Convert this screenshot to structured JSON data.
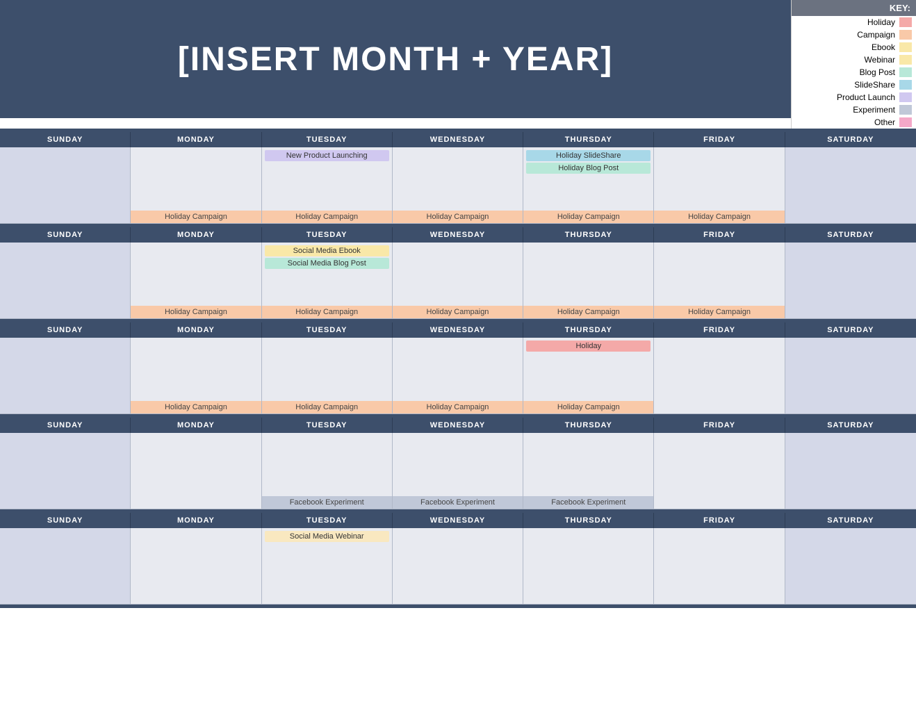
{
  "header": {
    "title": "[INSERT MONTH + YEAR]"
  },
  "key": {
    "label": "KEY:",
    "items": [
      {
        "name": "Holiday",
        "color": "#f4a9a8"
      },
      {
        "name": "Campaign",
        "color": "#f9c9a8"
      },
      {
        "name": "Ebook",
        "color": "#f9e8a8"
      },
      {
        "name": "Webinar",
        "color": "#f9e8a8"
      },
      {
        "name": "Blog Post",
        "color": "#b8e8d8"
      },
      {
        "name": "SlideShare",
        "color": "#a8d8e8"
      },
      {
        "name": "Product Launch",
        "color": "#d0c8f0"
      },
      {
        "name": "Experiment",
        "color": "#c0c8d8"
      },
      {
        "name": "Other",
        "color": "#f4a8c8"
      }
    ]
  },
  "days_of_week": [
    "SUNDAY",
    "MONDAY",
    "TUESDAY",
    "WEDNESDAY",
    "THURSDAY",
    "FRIDAY",
    "SATURDAY"
  ],
  "weeks": [
    {
      "days": [
        {
          "events": [],
          "bottom": ""
        },
        {
          "events": [],
          "bottom": "Holiday Campaign"
        },
        {
          "events": [
            "New Product Launching"
          ],
          "event_types": [
            "product"
          ],
          "bottom": "Holiday Campaign"
        },
        {
          "events": [],
          "bottom": "Holiday Campaign"
        },
        {
          "events": [
            "Holiday SlideShare",
            "Holiday Blog Post"
          ],
          "event_types": [
            "slideshare",
            "blog"
          ],
          "bottom": "Holiday Campaign"
        },
        {
          "events": [],
          "bottom": "Holiday Campaign"
        },
        {
          "events": [],
          "bottom": ""
        }
      ]
    },
    {
      "days": [
        {
          "events": [],
          "bottom": ""
        },
        {
          "events": [],
          "bottom": "Holiday Campaign"
        },
        {
          "events": [
            "Social Media Ebook",
            "Social Media Blog Post"
          ],
          "event_types": [
            "ebook",
            "blog"
          ],
          "bottom": "Holiday Campaign"
        },
        {
          "events": [],
          "bottom": "Holiday Campaign"
        },
        {
          "events": [],
          "bottom": "Holiday Campaign"
        },
        {
          "events": [],
          "bottom": "Holiday Campaign"
        },
        {
          "events": [],
          "bottom": ""
        }
      ]
    },
    {
      "days": [
        {
          "events": [],
          "bottom": ""
        },
        {
          "events": [],
          "bottom": "Holiday Campaign"
        },
        {
          "events": [],
          "bottom": "Holiday Campaign"
        },
        {
          "events": [],
          "bottom": "Holiday Campaign"
        },
        {
          "events": [
            "Holiday"
          ],
          "event_types": [
            "holiday"
          ],
          "bottom": "Holiday Campaign"
        },
        {
          "events": [],
          "bottom": ""
        },
        {
          "events": [],
          "bottom": ""
        }
      ]
    },
    {
      "days": [
        {
          "events": [],
          "bottom": ""
        },
        {
          "events": [],
          "bottom": ""
        },
        {
          "events": [],
          "bottom": "Facebook Experiment"
        },
        {
          "events": [],
          "bottom": "Facebook Experiment"
        },
        {
          "events": [],
          "bottom": "Facebook Experiment"
        },
        {
          "events": [],
          "bottom": ""
        },
        {
          "events": [],
          "bottom": ""
        }
      ]
    },
    {
      "days": [
        {
          "events": [],
          "bottom": ""
        },
        {
          "events": [],
          "bottom": ""
        },
        {
          "events": [
            "Social Media Webinar"
          ],
          "event_types": [
            "webinar"
          ],
          "bottom": ""
        },
        {
          "events": [],
          "bottom": ""
        },
        {
          "events": [],
          "bottom": ""
        },
        {
          "events": [],
          "bottom": ""
        },
        {
          "events": [],
          "bottom": ""
        }
      ]
    }
  ]
}
